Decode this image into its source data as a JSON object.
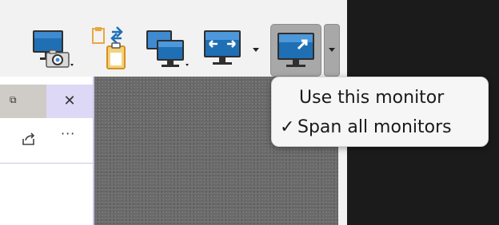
{
  "toolbar": {
    "buttons": [
      {
        "name": "screenshot-monitor",
        "icon": "monitor-camera-icon"
      },
      {
        "name": "clipboard-transfer",
        "icon": "clipboard-transfer-icon"
      },
      {
        "name": "multi-monitor",
        "icon": "multi-monitor-icon"
      },
      {
        "name": "fit-to-window",
        "icon": "monitor-arrows-icon"
      },
      {
        "name": "fullscreen",
        "icon": "monitor-expand-icon"
      }
    ]
  },
  "left_panel": {
    "restore_glyph": "⧉",
    "close_glyph": "✕",
    "share_glyph": "⇪",
    "more_glyph": "···"
  },
  "menu": {
    "items": [
      {
        "label": "Use this monitor",
        "checked": false,
        "check": ""
      },
      {
        "label": "Span all monitors",
        "checked": true,
        "check": "✓"
      }
    ]
  },
  "colors": {
    "monitor_blue": "#1f6fb5",
    "menu_bg": "#f6f6f6",
    "dark_bg": "#1b1b1b"
  }
}
